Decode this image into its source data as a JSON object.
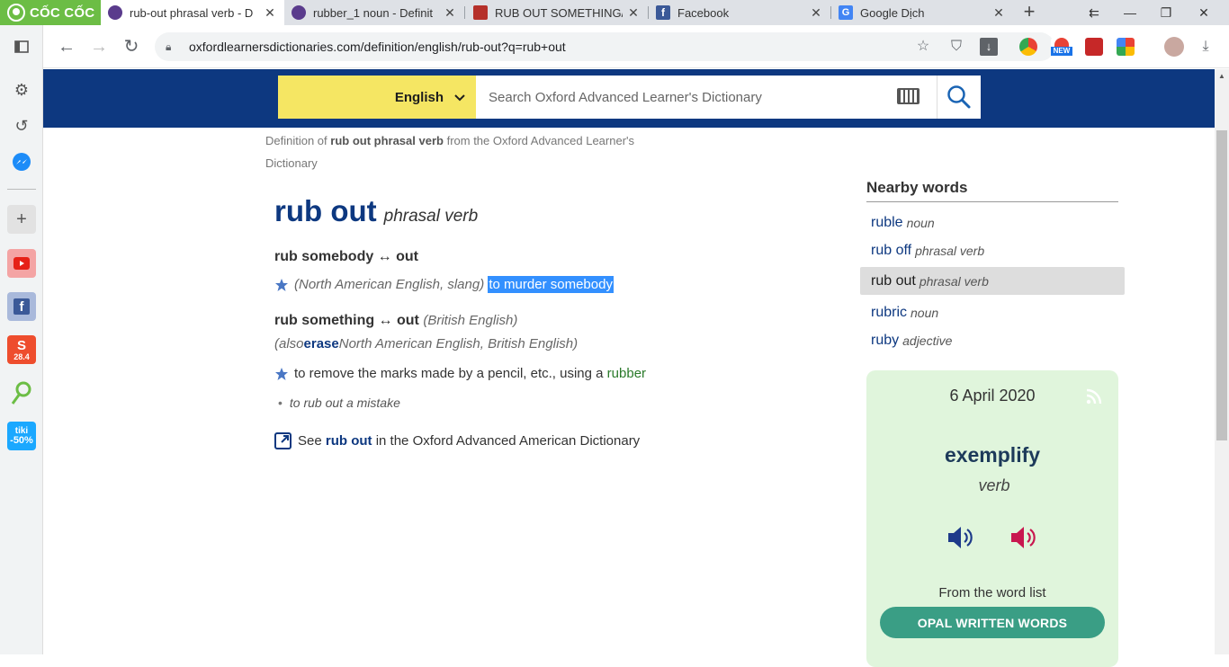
{
  "browser": {
    "brand": "CỐC CỐC",
    "tabs": [
      {
        "title": "rub-out phrasal verb - D",
        "active": true
      },
      {
        "title": "rubber_1 noun - Definit",
        "active": false
      },
      {
        "title": "RUB OUT SOMETHING/",
        "active": false
      },
      {
        "title": "Facebook",
        "active": false
      },
      {
        "title": "Google Dịch",
        "active": false
      }
    ],
    "url": "oxfordlearnersdictionaries.com/definition/english/rub-out?q=rub+out",
    "sidebar_badges": {
      "shopee": "28.4",
      "tiki_top": "tiki",
      "tiki_bottom": "-50%"
    },
    "ext_new_badge": "NEW"
  },
  "site": {
    "language": "English",
    "search_placeholder": "Search Oxford Advanced Learner's Dictionary"
  },
  "entry": {
    "crumb_pre": "Definition of ",
    "crumb_word": "rub out phrasal verb",
    "crumb_post": " from the Oxford Advanced Learner's Dictionary",
    "headword": "rub out",
    "pos": "phrasal verb",
    "pv1": "rub somebody ↔ out",
    "pv1_label": "(North American English, slang)",
    "pv1_def": "to murder somebody",
    "pv2": "rub something ↔ out",
    "pv2_label": "(British English)",
    "also_pre": "(also ",
    "also_word": "erase",
    "also_post": " North American English, British English)",
    "pv2_def": "to remove the marks made by a pencil, etc., using a ",
    "pv2_link": "rubber",
    "example": "to rub out a mistake",
    "see_pre": "See ",
    "see_word": "rub out",
    "see_post": " in the Oxford Advanced American Dictionary"
  },
  "nearby": {
    "title": "Nearby words",
    "items": [
      {
        "word": "ruble",
        "pos": "noun"
      },
      {
        "word": "rub off",
        "pos": "phrasal verb"
      },
      {
        "word": "rub out",
        "pos": "phrasal verb"
      },
      {
        "word": "rubric",
        "pos": "noun"
      },
      {
        "word": "ruby",
        "pos": "adjective"
      }
    ]
  },
  "wotd": {
    "date": "6 April 2020",
    "word": "exemplify",
    "pos": "verb",
    "from": "From the word list",
    "list_button": "OPAL WRITTEN WORDS"
  },
  "colors": {
    "oxford_blue": "#0d3880",
    "lang_yellow": "#f5e663",
    "selection": "#3390ff",
    "wotd_bg": "#e0f5dc",
    "opal_green": "#3a9e85"
  }
}
